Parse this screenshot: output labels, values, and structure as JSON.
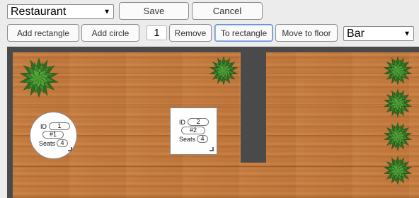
{
  "toolbar": {
    "layout_select_value": "Restaurant",
    "save_label": "Save",
    "cancel_label": "Cancel",
    "add_rectangle_label": "Add rectangle",
    "add_circle_label": "Add circle",
    "selected_count": "1",
    "remove_label": "Remove",
    "to_rectangle_label": "To rectangle",
    "move_to_floor_label": "Move to floor",
    "floor_select_value": "Bar"
  },
  "tables": [
    {
      "id_label": "ID",
      "id_value": "1",
      "name_value": "#1",
      "seats_label": "Seats",
      "seats_value": "4"
    },
    {
      "id_label": "ID",
      "id_value": "2",
      "name_value": "#2",
      "seats_label": "Seats",
      "seats_value": "4"
    }
  ],
  "colors": {
    "floor_wood": "#c47a3e",
    "wall": "#4a4a4a",
    "plant": "#3f8a2e"
  },
  "icons": {
    "dropdown": "chevron-down-icon",
    "plant": "plant-icon",
    "resize": "resize-handle-icon"
  }
}
